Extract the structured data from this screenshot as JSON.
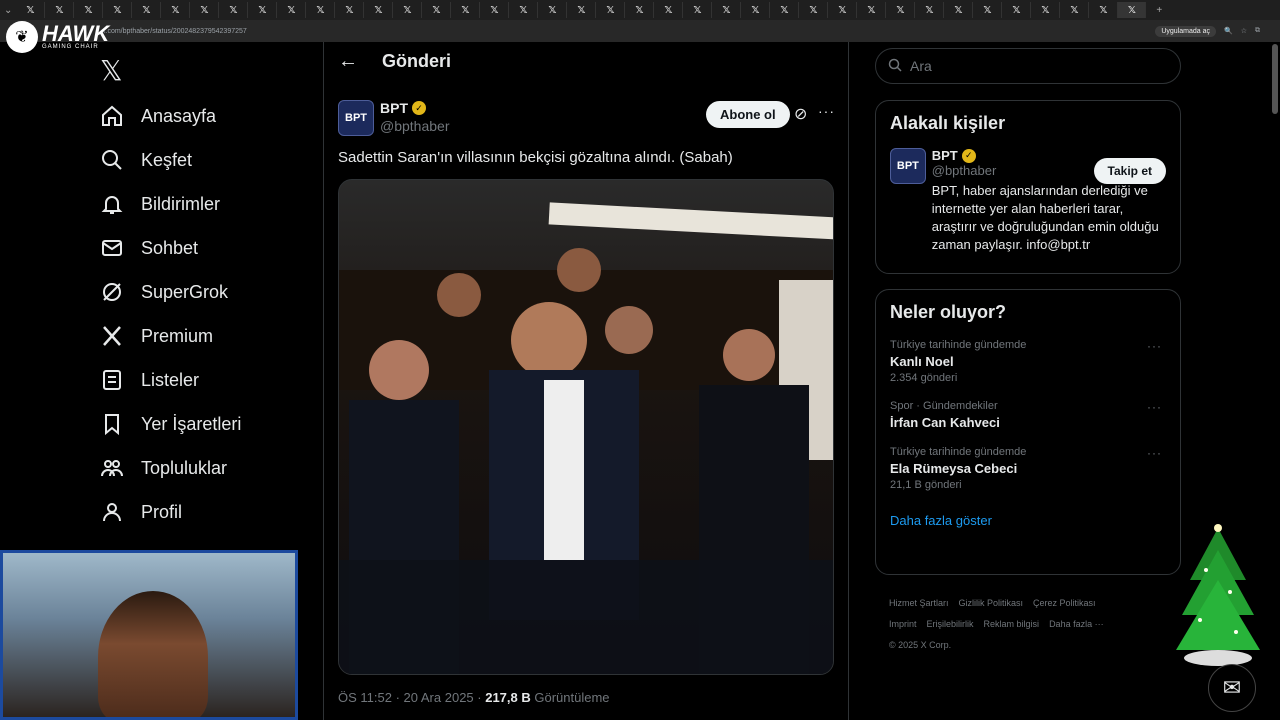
{
  "browser": {
    "url": "x.com/bpthaber/status/2002482379542397257",
    "open_in_app": "Uygulamada aç"
  },
  "overlay": {
    "brand_title": "HAWK",
    "brand_sub": "GAMING CHAIR"
  },
  "nav": {
    "items": [
      {
        "label": "Anasayfa",
        "icon": "home-icon"
      },
      {
        "label": "Keşfet",
        "icon": "search-icon"
      },
      {
        "label": "Bildirimler",
        "icon": "bell-icon"
      },
      {
        "label": "Sohbet",
        "icon": "mail-icon"
      },
      {
        "label": "SuperGrok",
        "icon": "grok-icon"
      },
      {
        "label": "Premium",
        "icon": "x-icon"
      },
      {
        "label": "Listeler",
        "icon": "list-icon"
      },
      {
        "label": "Yer İşaretleri",
        "icon": "bookmark-icon"
      },
      {
        "label": "Topluluklar",
        "icon": "communities-icon"
      },
      {
        "label": "Profil",
        "icon": "profile-icon"
      }
    ]
  },
  "header": {
    "title": "Gönderi"
  },
  "post": {
    "author_name": "BPT",
    "author_handle": "@bpthaber",
    "avatar_text": "BPT",
    "subscribe_label": "Abone ol",
    "text": "Sadettin Saran'ın villasının bekçisi gözaltına alındı. (Sabah)",
    "time": "ÖS 11:52",
    "date": "20 Ara 2025",
    "views_count": "217,8 B",
    "views_label": "Görüntüleme"
  },
  "search": {
    "placeholder": "Ara"
  },
  "related": {
    "title": "Alakalı kişiler",
    "name": "BPT",
    "handle": "@bpthaber",
    "follow_label": "Takip et",
    "bio": "BPT, haber ajanslarından derlediği ve internette yer alan haberleri tarar, araştırır ve doğruluğundan emin olduğu zaman paylaşır. info@bpt.tr"
  },
  "trends": {
    "title": "Neler oluyor?",
    "items": [
      {
        "category": "Türkiye tarihinde gündemde",
        "topic": "Kanlı Noel",
        "count": "2.354 gönderi"
      },
      {
        "category": "Spor · Gündemdekiler",
        "topic": "İrfan Can Kahveci",
        "count": ""
      },
      {
        "category": "Türkiye tarihinde gündemde",
        "topic": "Ela Rümeysa Cebeci",
        "count": "21,1 B gönderi"
      }
    ],
    "show_more": "Daha fazla göster"
  },
  "footer": {
    "links": [
      "Hizmet Şartları",
      "Gizlilik Politikası",
      "Çerez Politikası",
      "Erişilebilirlik",
      "Reklam bilgisi",
      "Daha fazla ···"
    ],
    "imprint": "Imprint",
    "copyright": "© 2025 X Corp."
  },
  "colors": {
    "accent": "#1d9bf0",
    "verified": "#e2b719",
    "background": "#000000",
    "border": "#2f3336"
  }
}
